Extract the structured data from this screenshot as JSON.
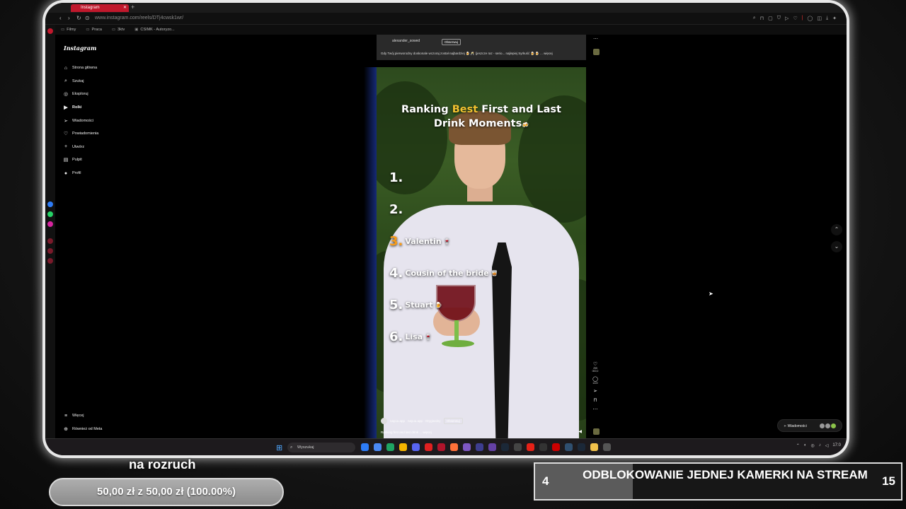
{
  "browser": {
    "tab_title": "Instagram",
    "url": "www.instagram.com/reels/DTj4cwsk1wr/",
    "bookmarks": [
      "Filmy",
      "Praca",
      "3ktv",
      "CSIMK - Autoryzo..."
    ]
  },
  "instagram": {
    "logo": "Instagram",
    "nav": [
      {
        "label": "Strona główna",
        "icon": "⌂"
      },
      {
        "label": "Szukaj",
        "icon": "⌕"
      },
      {
        "label": "Eksploruj",
        "icon": "◎"
      },
      {
        "label": "Rolki",
        "icon": "▶"
      },
      {
        "label": "Wiadomości",
        "icon": "➢"
      },
      {
        "label": "Powiadomienia",
        "icon": "♡"
      },
      {
        "label": "Utwórz",
        "icon": "+"
      },
      {
        "label": "Pulpit",
        "icon": "▤"
      },
      {
        "label": "Profil",
        "icon": "●"
      }
    ],
    "nav_bottom": [
      {
        "label": "Więcej",
        "icon": "≡"
      },
      {
        "label": "Również od Meta",
        "icon": "⊕"
      }
    ],
    "prev_reel": {
      "username": "alexander_sowed",
      "follow_label": "Obserwuj",
      "caption": "Gdy Twój pierworodny doskonale wczoraj został najbardziej 🍺 🥂 (jeszcze raz - serio... najlepiej Syrkuść 🍺 🍺 ... więcej"
    },
    "reel": {
      "title_part1": "Ranking",
      "title_highlight": "Best",
      "title_part2": "First and Last",
      "title_line2": "Drink Moments",
      "title_emoji": "🍻",
      "ranks": [
        {
          "num": "1.",
          "name": "",
          "emoji": ""
        },
        {
          "num": "2.",
          "name": "",
          "emoji": ""
        },
        {
          "num": "3.",
          "name": "Valentin",
          "emoji": "🍷"
        },
        {
          "num": "4.",
          "name": "Cousin of the bride",
          "emoji": "🥃"
        },
        {
          "num": "5.",
          "name": "Stuart",
          "emoji": "🍺"
        },
        {
          "num": "6.",
          "name": "Lisa",
          "emoji": "🍷"
        }
      ],
      "username": "nayuu.app",
      "audio": "nayuu.app · Oryginalny",
      "follow_label": "Obserwuj",
      "caption": "Ranking first and last drink ... więcej",
      "likes": "255 000,0",
      "comments": "1222"
    },
    "messages_label": "Wiadomości"
  },
  "taskbar": {
    "search_placeholder": "Wyszukaj",
    "time": "17:0"
  },
  "overlay": {
    "donation_label": "na rozruch",
    "donation_text": "50,00 zł z 50,00 zł (100.00%)",
    "donation_progress": 1.0,
    "goal_current": "4",
    "goal_title": "ODBLOKOWANIE JEDNEJ KAMERKI NA STREAM",
    "goal_max": "15",
    "goal_progress": 0.2667
  }
}
